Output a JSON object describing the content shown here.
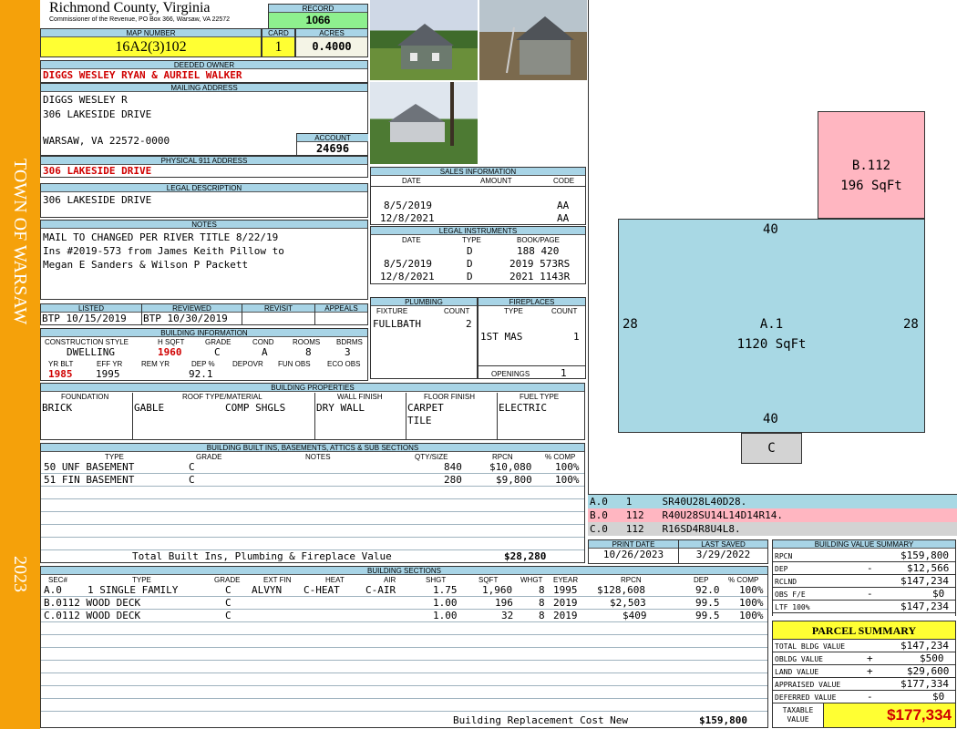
{
  "sidebar": {
    "town": "TOWN OF WARSAW",
    "year": "2023"
  },
  "header": {
    "county": "Richmond County, Virginia",
    "commissioner": "Commissioner of the Revenue, PO Box 366, Warsaw, VA 22572",
    "record_label": "RECORD",
    "record": "1066",
    "map_label": "MAP NUMBER",
    "map_number": "16A2(3)102",
    "card_label": "CARD",
    "card": "1",
    "acres_label": "ACRES",
    "acres": "0.4000"
  },
  "owner": {
    "label": "DEEDED OWNER",
    "value": "DIGGS WESLEY RYAN & AURIEL WALKER"
  },
  "mailing": {
    "label": "MAILING ADDRESS",
    "line1": "DIGGS WESLEY R",
    "line2": "306 LAKESIDE DRIVE",
    "line3": "WARSAW, VA 22572-0000",
    "account_label": "ACCOUNT",
    "account": "24696"
  },
  "physical": {
    "label": "PHYSICAL 911 ADDRESS",
    "value": "306 LAKESIDE DRIVE"
  },
  "legal": {
    "label": "LEGAL DESCRIPTION",
    "value": "306 LAKESIDE DRIVE"
  },
  "notes": {
    "label": "NOTES",
    "lines": [
      "MAIL TO CHANGED PER RIVER TITLE 8/22/19",
      "Ins #2019-573 from James Keith Pillow to",
      "Megan E Sanders & Wilson P Packett"
    ]
  },
  "dates": {
    "listed_label": "LISTED",
    "listed": "BTP 10/15/2019",
    "reviewed_label": "REVIEWED",
    "reviewed": "BTP 10/30/2019",
    "revisit_label": "REVISIT",
    "appeals_label": "APPEALS"
  },
  "building_info": {
    "label": "BUILDING INFORMATION",
    "h1": [
      "CONSTRUCTION STYLE",
      "H SQFT",
      "GRADE",
      "COND",
      "ROOMS",
      "BDRMS"
    ],
    "v1": [
      "DWELLING",
      "1960",
      "C",
      "A",
      "8",
      "3"
    ],
    "h2": [
      "YR BLT",
      "EFF YR",
      "REM YR",
      "DEP %",
      "DEPOVR",
      "FUN OBS",
      "ECO OBS"
    ],
    "v2": [
      "1985",
      "1995",
      "",
      "92.1",
      "",
      "",
      ""
    ]
  },
  "sales": {
    "label": "SALES INFORMATION",
    "cols": [
      "DATE",
      "AMOUNT",
      "CODE"
    ],
    "rows": [
      [
        "8/5/2019",
        "",
        "AA"
      ],
      [
        "12/8/2021",
        "",
        "AA"
      ]
    ]
  },
  "instruments": {
    "label": "LEGAL INSTRUMENTS",
    "cols": [
      "DATE",
      "TYPE",
      "BOOK/PAGE"
    ],
    "rows": [
      [
        "",
        "D",
        "188 420"
      ],
      [
        "8/5/2019",
        "D",
        "2019 573RS"
      ],
      [
        "12/8/2021",
        "D",
        "2021 1143R"
      ]
    ]
  },
  "plumbing": {
    "label": "PLUMBING",
    "cols": [
      "FIXTURE",
      "COUNT"
    ],
    "rows": [
      [
        "FULLBATH",
        "2"
      ]
    ]
  },
  "fireplaces": {
    "label": "FIREPLACES",
    "cols": [
      "TYPE",
      "COUNT"
    ],
    "rows": [
      [
        "1ST MAS",
        "1"
      ]
    ],
    "openings_label": "OPENINGS",
    "openings": "1"
  },
  "properties": {
    "label": "BUILDING PROPERTIES",
    "cols": [
      "FOUNDATION",
      "ROOF TYPE/MATERIAL",
      "WALL FINISH",
      "FLOOR FINISH",
      "FUEL TYPE"
    ],
    "foundation": "BRICK",
    "roof_type": "GABLE",
    "roof_material": "COMP SHGLS",
    "wall": "DRY WALL",
    "floor1": "CARPET",
    "floor2": "TILE",
    "fuel": "ELECTRIC"
  },
  "builtins": {
    "label": "BUILDING BUILT INS, BASEMENTS, ATTICS & SUB SECTIONS",
    "cols": [
      "TYPE",
      "GRADE",
      "NOTES",
      "QTY/SIZE",
      "RPCN",
      "% COMP"
    ],
    "rows": [
      [
        "50 UNF BASEMENT",
        "C",
        "",
        "840",
        "$10,080",
        "100%"
      ],
      [
        "51 FIN BASEMENT",
        "C",
        "",
        "280",
        "$9,800",
        "100%"
      ]
    ],
    "total_label": "Total Built Ins, Plumbing & Fireplace Value",
    "total": "$28,280"
  },
  "sections": {
    "label": "BUILDING SECTIONS",
    "cols": [
      "SEC#",
      "TYPE",
      "GRADE",
      "EXT FIN",
      "HEAT",
      "AIR",
      "SHGT",
      "SQFT",
      "WHGT",
      "EYEAR",
      "RPCN",
      "DEP",
      "% COMP"
    ],
    "rows": [
      [
        "A.0",
        "1 SINGLE FAMILY",
        "C",
        "ALVYN",
        "C-HEAT",
        "C-AIR",
        "1.75",
        "1,960",
        "8",
        "1995",
        "$128,608",
        "92.0",
        "100%"
      ],
      [
        "B.0",
        "112 WOOD DECK",
        "C",
        "",
        "",
        "",
        "1.00",
        "196",
        "8",
        "2019",
        "$2,503",
        "99.5",
        "100%"
      ],
      [
        "C.0",
        "112 WOOD DECK",
        "C",
        "",
        "",
        "",
        "1.00",
        "32",
        "8",
        "2019",
        "$409",
        "99.5",
        "100%"
      ]
    ],
    "replacement_label": "Building Replacement Cost New",
    "replacement": "$159,800"
  },
  "sketch": {
    "B": {
      "name": "B.112",
      "area": "196 SqFt"
    },
    "A": {
      "name": "A.1",
      "area": "1120 SqFt",
      "top": "40",
      "bottom": "40",
      "left": "28",
      "right": "28"
    },
    "C": {
      "name": "C"
    },
    "codes": [
      {
        "sec": "A.0",
        "code": "1",
        "vector": "SR40U28L40D28."
      },
      {
        "sec": "B.0",
        "code": "112",
        "vector": "R40U28SU14L14D14R14."
      },
      {
        "sec": "C.0",
        "code": "112",
        "vector": "R16SD4R8U4L8."
      }
    ],
    "colors": {
      "A": "#a8d8e4",
      "B": "#ffb6c1",
      "C": "#d3d3d3"
    }
  },
  "print": {
    "print_label": "PRINT DATE",
    "print_date": "10/26/2023",
    "saved_label": "LAST SAVED",
    "saved_date": "3/29/2022"
  },
  "value_summary": {
    "label": "BUILDING VALUE SUMMARY",
    "rows": [
      [
        "RPCN",
        "",
        "$159,800"
      ],
      [
        "DEP",
        "-",
        "$12,566"
      ],
      [
        "RCLND",
        "",
        "$147,234"
      ],
      [
        "OBS F/E",
        "-",
        "$0"
      ],
      [
        "LTF 100%",
        "",
        "$147,234"
      ]
    ]
  },
  "parcel": {
    "label": "PARCEL SUMMARY",
    "rows": [
      [
        "TOTAL BLDG VALUE",
        "",
        "$147,234"
      ],
      [
        "OBLDG VALUE",
        "+",
        "$500"
      ],
      [
        "LAND VALUE",
        "+",
        "$29,600"
      ],
      [
        "APPRAISED VALUE",
        "",
        "$177,334"
      ],
      [
        "DEFERRED VALUE",
        "-",
        "$0"
      ]
    ],
    "taxable_label1": "TAXABLE",
    "taxable_label2": "VALUE",
    "taxable": "$177,334"
  }
}
